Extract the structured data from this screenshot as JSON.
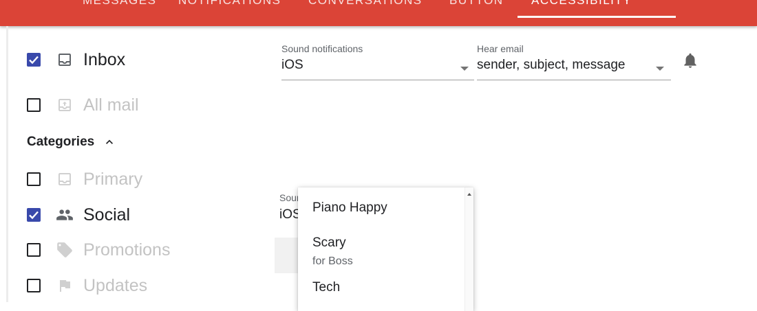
{
  "tabs": [
    "Messages",
    "Notifications",
    "Conversations",
    "Button",
    "Accessibility"
  ],
  "sidebar": {
    "items": [
      {
        "label": "Inbox",
        "checked": true,
        "icon": "inbox-icon"
      },
      {
        "label": "All mail",
        "checked": false,
        "icon": "all-mail-icon"
      }
    ],
    "categories_label": "Categories",
    "categories": [
      {
        "label": "Primary",
        "checked": false,
        "icon": "primary-inbox-icon"
      },
      {
        "label": "Social",
        "checked": true,
        "icon": "people-icon"
      },
      {
        "label": "Promotions",
        "checked": false,
        "icon": "tag-icon"
      },
      {
        "label": "Updates",
        "checked": false,
        "icon": "flag-icon"
      }
    ]
  },
  "settings": {
    "sound_label": "Sound notifications",
    "sound_value": "iOS",
    "hear_label": "Hear email",
    "hear_value": "sender, subject, message",
    "second_sound_label": "Sound notifications",
    "second_sound_value": "iOS"
  },
  "dropdown": {
    "options": [
      {
        "label": "Piano Happy"
      },
      {
        "label": "Scary",
        "sub": "for Boss"
      },
      {
        "label": "Tech"
      }
    ]
  },
  "colors": {
    "accent": "#db4437",
    "checkbox": "#3949ab"
  }
}
